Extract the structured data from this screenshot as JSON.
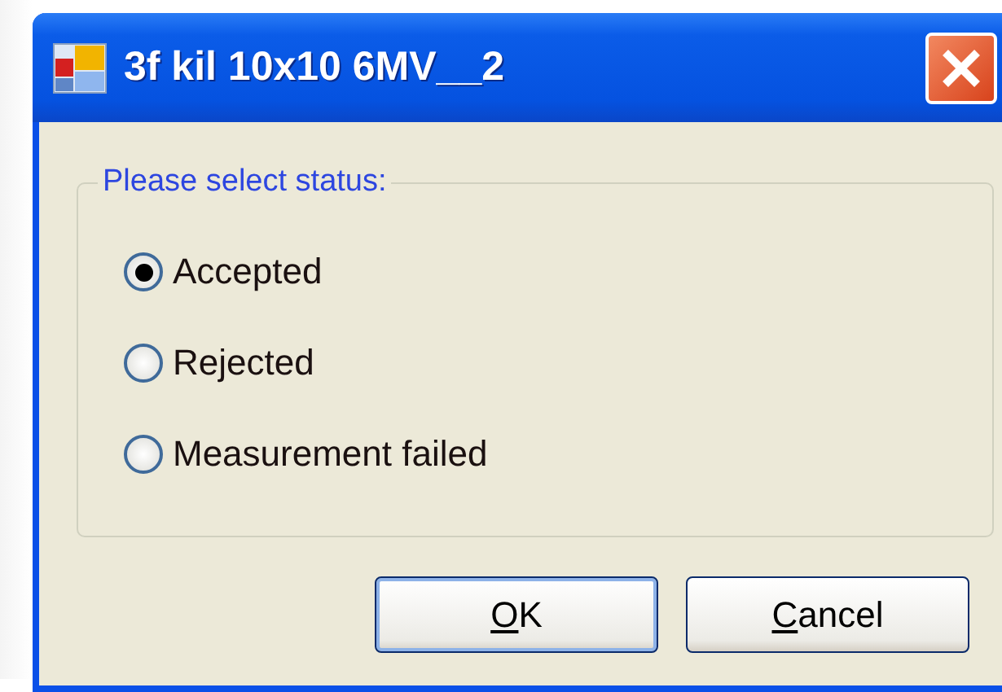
{
  "window": {
    "title": "3f kil 10x10 6MV__2"
  },
  "group": {
    "label": "Please select status:",
    "options": [
      {
        "label": "Accepted",
        "selected": true
      },
      {
        "label": "Rejected",
        "selected": false
      },
      {
        "label": "Measurement failed",
        "selected": false
      }
    ]
  },
  "buttons": [
    {
      "access_key": "O",
      "label_rest": "K",
      "default": true
    },
    {
      "access_key": "C",
      "label_rest": "ancel",
      "default": false
    }
  ]
}
